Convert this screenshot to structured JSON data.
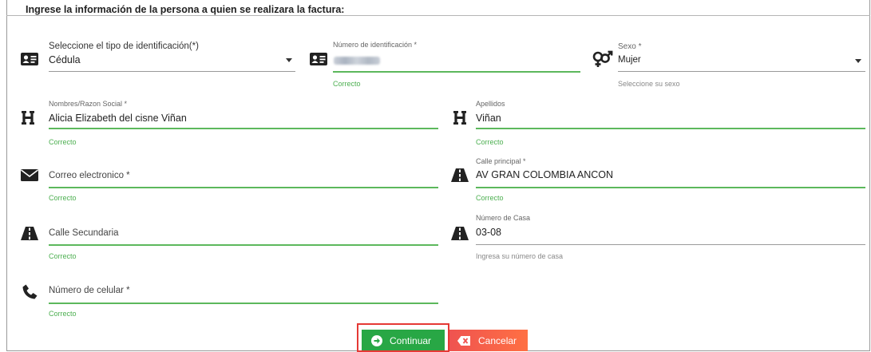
{
  "heading": "Ingrese la información de la persona a quien se realizara la factura:",
  "tipo_id": {
    "label": "Seleccione el tipo de identificación(*)",
    "value": "Cédula",
    "icon": "id-card-icon"
  },
  "numero_id": {
    "label": "Número de identificación *",
    "helper": "Correcto",
    "icon": "id-card-icon"
  },
  "sexo": {
    "label": "Sexo *",
    "value": "Mujer",
    "helper": "Seleccione su sexo",
    "icon": "gender-icon"
  },
  "nombres": {
    "label": "Nombres/Razon Social *",
    "value": "Alicia Elizabeth del cisne Viñan",
    "helper": "Correcto",
    "icon": "letter-h-icon"
  },
  "apellidos": {
    "label": "Apellidos",
    "value": "Viñan",
    "helper": "Correcto",
    "icon": "letter-h-icon"
  },
  "correo": {
    "placeholder": "Correo electronico *",
    "helper": "Correcto",
    "icon": "envelope-icon"
  },
  "calle_principal": {
    "label": "Calle principal *",
    "value": "AV GRAN COLOMBIA ANCON",
    "helper": "Correcto",
    "icon": "road-icon"
  },
  "calle_secundaria": {
    "placeholder": "Calle Secundaria",
    "helper": "Correcto",
    "icon": "road-icon"
  },
  "numero_casa": {
    "label": "Número de Casa",
    "value": "03-08",
    "helper": "Ingresa su número de casa",
    "icon": "road-icon"
  },
  "celular": {
    "placeholder": "Número de celular *",
    "helper": "Correcto",
    "icon": "phone-icon"
  },
  "buttons": {
    "continue": "Continuar",
    "cancel": "Cancelar"
  },
  "colors": {
    "success": "#5cb85c",
    "continue_bg": "#28a745",
    "cancel_bg": "#ef5350",
    "highlight": "#e53935"
  }
}
